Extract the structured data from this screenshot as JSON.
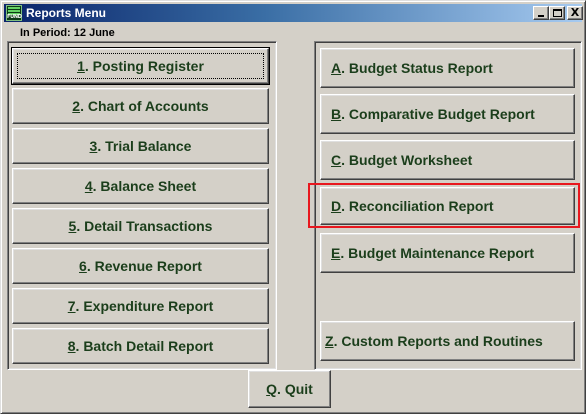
{
  "window": {
    "title": "Reports Menu",
    "app_icon_text": "FUND",
    "close_glyph": "X"
  },
  "header": {
    "period_label": "In Period: 12 June"
  },
  "left_buttons": [
    {
      "key": "1",
      "label": ".  Posting Register"
    },
    {
      "key": "2",
      "label": ".  Chart of Accounts"
    },
    {
      "key": "3",
      "label": ".  Trial Balance"
    },
    {
      "key": "4",
      "label": ".  Balance Sheet"
    },
    {
      "key": "5",
      "label": ". Detail Transactions"
    },
    {
      "key": "6",
      "label": ". Revenue Report"
    },
    {
      "key": "7",
      "label": ".  Expenditure Report"
    },
    {
      "key": "8",
      "label": ". Batch Detail Report"
    }
  ],
  "right_buttons": [
    {
      "key": "A",
      "label": ". Budget Status Report"
    },
    {
      "key": "B",
      "label": ". Comparative Budget Report"
    },
    {
      "key": "C",
      "label": ". Budget Worksheet"
    },
    {
      "key": "D",
      "label": ". Reconciliation Report"
    },
    {
      "key": "E",
      "label": ". Budget Maintenance Report"
    },
    {
      "key": "Z",
      "label": ". Custom Reports and Routines"
    }
  ],
  "footer": {
    "quit_key": "Q",
    "quit_label": ".  Quit"
  },
  "colors": {
    "button_text": "#1b3e1b",
    "highlight": "#e8171e",
    "titlebar_start": "#0a246a",
    "titlebar_end": "#a6caf0"
  }
}
